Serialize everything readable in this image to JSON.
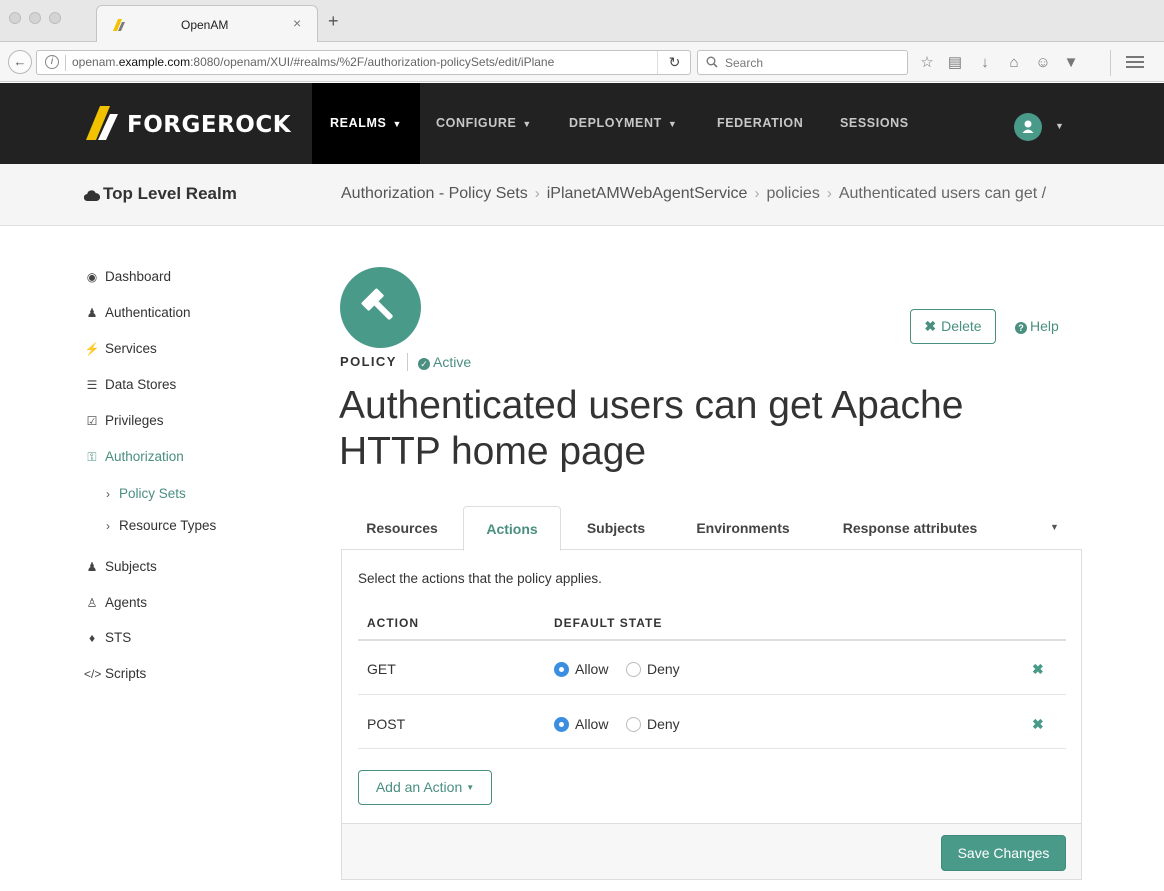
{
  "browser": {
    "tab_title": "OpenAM",
    "tab_close": "×",
    "new_tab": "+",
    "url_prefix": "openam.",
    "url_host": "example.com",
    "url_rest": ":8080/openam/XUI/#realms/%2F/authorization-policySets/edit/iPlane",
    "search_placeholder": "Search"
  },
  "header": {
    "brand": "FORGEROCK",
    "nav": [
      {
        "label": "REALMS"
      },
      {
        "label": "CONFIGURE"
      },
      {
        "label": "DEPLOYMENT"
      },
      {
        "label": "FEDERATION"
      },
      {
        "label": "SESSIONS"
      }
    ]
  },
  "subheader": {
    "realm": "Top Level Realm",
    "breadcrumb": [
      "Authorization - Policy Sets",
      "iPlanetAMWebAgentService",
      "policies",
      "Authenticated users can get /"
    ]
  },
  "sidebar": {
    "items": [
      {
        "label": "Dashboard",
        "icon": "dashboard-icon"
      },
      {
        "label": "Authentication",
        "icon": "user-icon"
      },
      {
        "label": "Services",
        "icon": "plug-icon"
      },
      {
        "label": "Data Stores",
        "icon": "database-icon"
      },
      {
        "label": "Privileges",
        "icon": "checkbox-icon"
      },
      {
        "label": "Authorization",
        "icon": "key-icon"
      },
      {
        "label": "Policy Sets"
      },
      {
        "label": "Resource Types"
      },
      {
        "label": "Subjects",
        "icon": "users-icon"
      },
      {
        "label": "Agents",
        "icon": "agent-icon"
      },
      {
        "label": "STS",
        "icon": "tag-icon"
      },
      {
        "label": "Scripts",
        "icon": "code-icon"
      }
    ]
  },
  "policy": {
    "label": "POLICY",
    "status": "Active",
    "title": "Authenticated users can get Apache HTTP home page",
    "delete_label": "Delete",
    "help_label": "Help"
  },
  "tabs": [
    {
      "label": "Resources"
    },
    {
      "label": "Actions"
    },
    {
      "label": "Subjects"
    },
    {
      "label": "Environments"
    },
    {
      "label": "Response attributes"
    }
  ],
  "actions_panel": {
    "description": "Select the actions that the policy applies.",
    "col_action": "ACTION",
    "col_default": "DEFAULT STATE",
    "allow_label": "Allow",
    "deny_label": "Deny",
    "rows": [
      {
        "action": "GET",
        "state": "Allow"
      },
      {
        "action": "POST",
        "state": "Allow"
      }
    ],
    "add_label": "Add an Action",
    "save_label": "Save Changes"
  },
  "colors": {
    "accent": "#4a8f80",
    "header_bg": "#222222",
    "radio_selected": "#3b8ee0"
  }
}
